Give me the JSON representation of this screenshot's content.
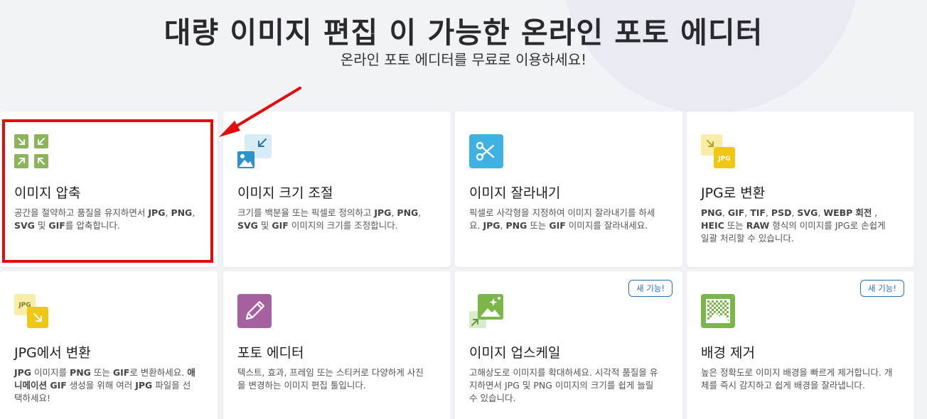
{
  "hero": {
    "title": "대량 이미지 편집 이 가능한 온라인 포토 에디터",
    "subtitle": "온라인 포토 에디터를 무료로 이용하세요!"
  },
  "cards": [
    {
      "title": "이미지 압축",
      "desc_parts": [
        "공간을 절약하고 품질을 유지하면서 ",
        "JPG",
        ", ",
        "PNG",
        ", ",
        "SVG",
        " 및 ",
        "GIF",
        "를 압축합니다."
      ]
    },
    {
      "title": "이미지 크기 조절",
      "desc_parts": [
        "크기를 백분율 또는 픽셀로 정의하고 ",
        "JPG",
        ", ",
        "PNG",
        ", ",
        "SVG",
        " 및 ",
        "GIF",
        " 이미지의 크기를 조정합니다."
      ]
    },
    {
      "title": "이미지 잘라내기",
      "desc_parts": [
        "픽셀로 사각형을 지정하여 이미지 잘라내기를 하세요. ",
        "JPG",
        ", ",
        "PNG",
        " 또는 ",
        "GIF",
        " 이미지를 잘라내세요."
      ]
    },
    {
      "title": "JPG로 변환",
      "desc_parts": [
        "",
        "PNG",
        ", ",
        "GIF",
        ", ",
        "TIF",
        ", ",
        "PSD",
        ", ",
        "SVG",
        ", ",
        "WEBP",
        " ",
        "회전",
        " , ",
        "HEIC",
        " 또는 ",
        "RAW",
        " 형식의 이미지를 JPG로 손쉽게 일괄 처리할 수 있습니다."
      ]
    },
    {
      "title": "JPG에서 변환",
      "desc_parts": [
        "",
        "JPG",
        " 이미지를 ",
        "PNG",
        " 또는 ",
        "GIF",
        "로 변환하세요. ",
        "애니메이션 GIF",
        " 생성을 위해 여러 ",
        "JPG",
        " 파일을 선택하세요!"
      ]
    },
    {
      "title": "포토 에디터",
      "desc_parts": [
        "텍스트, 효과, 프레임 또는 스티커로 다양하게 사진을 변경하는 이미지 편집 툴입니다."
      ]
    },
    {
      "title": "이미지 업스케일",
      "desc_parts": [
        "고해상도로 이미지를 확대하세요. 시각적 품질을 유지하면서 JPG 및 PNG 이미지의 크기를 쉽게 늘릴 수 있습니다."
      ],
      "badge": "새 기능!"
    },
    {
      "title": "배경 제거",
      "desc_parts": [
        "높은 정확도로 이미지 배경을 빠르게 제거합니다. 개체를 즉시 감지하고 쉽게 배경을 잘라냅니다."
      ],
      "badge": "새 기능!"
    }
  ],
  "icons": {
    "jpg_label": "JPG"
  },
  "colors": {
    "compress": "#8cb45a",
    "resize": "#2b93c9",
    "crop": "#3fb1e3",
    "convert_to_jpg": "#f0c814",
    "photo_editor": "#a7609f",
    "upscale": "#7ab648",
    "remove_bg": "#7ab648",
    "highlight": "#e40b0b"
  }
}
